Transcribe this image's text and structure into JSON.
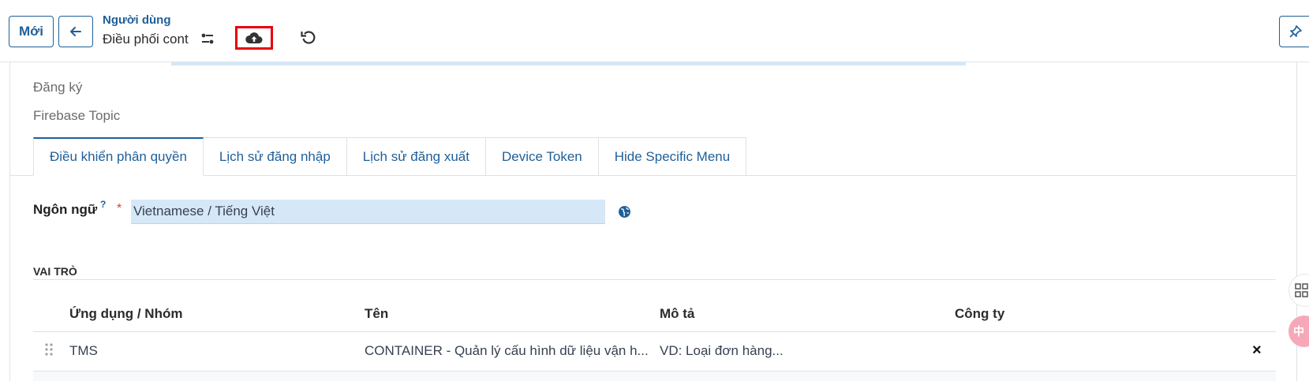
{
  "toolbar": {
    "new_label": "Mới",
    "breadcrumb_parent": "Người dùng",
    "breadcrumb_current": "Điều phối cont"
  },
  "form": {
    "field_subscribe": "Đăng ký",
    "field_firebase_topic": "Firebase Topic",
    "tabs": [
      {
        "label": "Điều khiển phân quyền"
      },
      {
        "label": "Lịch sử đăng nhập"
      },
      {
        "label": "Lịch sử đăng xuất"
      },
      {
        "label": "Device Token"
      },
      {
        "label": "Hide Specific Menu"
      }
    ],
    "language": {
      "label": "Ngôn ngữ",
      "help": "?",
      "required": "*",
      "value": "Vietnamese / Tiếng Việt"
    },
    "roles": {
      "title": "VAI TRÒ",
      "columns": [
        "Ứng dụng / Nhóm",
        "Tên",
        "Mô tả",
        "Công ty"
      ],
      "rows": [
        {
          "app": "TMS",
          "name": "CONTAINER - Quản lý cấu hình dữ liệu vận h...",
          "description": "VD: Loại đơn hàng...",
          "company": ""
        }
      ],
      "delete_glyph": "×"
    }
  },
  "side": {
    "translate_glyph": "中"
  },
  "colors": {
    "primary": "#1f5f99",
    "highlight_border": "#e8000b",
    "input_bg": "#d6e8f7",
    "required": "#e03b3b"
  }
}
